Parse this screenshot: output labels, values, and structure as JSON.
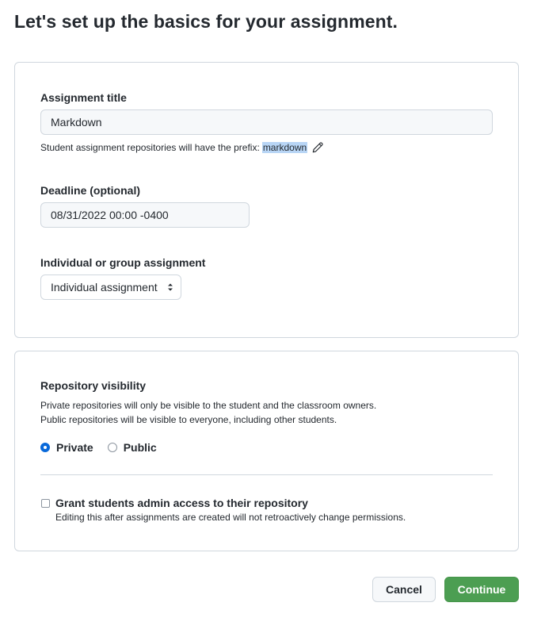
{
  "page": {
    "title": "Let's set up the basics for your assignment."
  },
  "basics": {
    "assignment_title": {
      "label": "Assignment title",
      "value": "Markdown"
    },
    "prefix_hint": {
      "text": "Student assignment repositories will have the prefix:",
      "prefix": "markdown",
      "edit_icon": "pencil-icon"
    },
    "deadline": {
      "label": "Deadline (optional)",
      "value": "08/31/2022 00:00 -0400"
    },
    "assignment_type": {
      "label": "Individual or group assignment",
      "selected": "Individual assignment"
    }
  },
  "repository": {
    "visibility_label": "Repository visibility",
    "visibility_desc_1": "Private repositories will only be visible to the student and the classroom owners.",
    "visibility_desc_2": "Public repositories will be visible to everyone, including other students.",
    "options": [
      {
        "label": "Private",
        "checked": true
      },
      {
        "label": "Public",
        "checked": false
      }
    ],
    "admin_access": {
      "label": "Grant students admin access to their repository",
      "note": "Editing this after assignments are created will not retroactively change permissions.",
      "checked": false
    }
  },
  "actions": {
    "cancel_label": "Cancel",
    "continue_label": "Continue"
  },
  "colors": {
    "accent_blue": "#0969da",
    "continue_green": "#4c9e52",
    "border": "#d0d7de",
    "prefix_highlight": "#b8d5f5"
  }
}
